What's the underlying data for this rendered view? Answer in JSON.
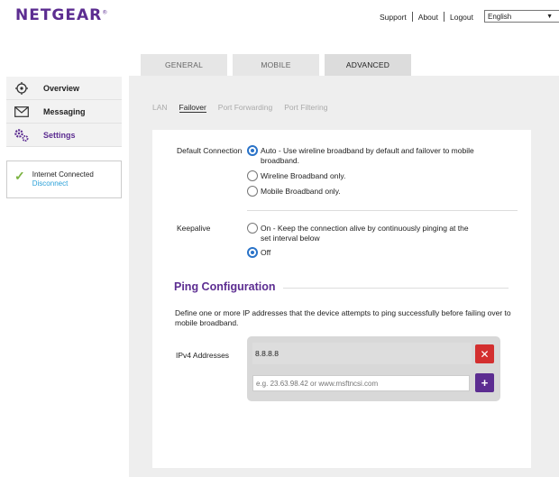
{
  "brand": {
    "name": "NETGEAR",
    "mark": "®"
  },
  "header": {
    "links": [
      "Support",
      "About",
      "Logout"
    ],
    "language": "English"
  },
  "tabs": [
    {
      "label": "GENERAL",
      "active": false
    },
    {
      "label": "MOBILE",
      "active": false
    },
    {
      "label": "ADVANCED",
      "active": true
    }
  ],
  "sidebar": {
    "items": [
      {
        "label": "Overview",
        "icon": "network-globe-icon",
        "active": false
      },
      {
        "label": "Messaging",
        "icon": "envelope-icon",
        "active": false
      },
      {
        "label": "Settings",
        "icon": "gears-icon",
        "active": true
      }
    ],
    "status": {
      "text": "Internet Connected",
      "link": "Disconnect",
      "icon": "checkmark-icon"
    }
  },
  "subtabs": [
    {
      "label": "LAN",
      "active": false
    },
    {
      "label": "Failover",
      "active": true
    },
    {
      "label": "Port Forwarding",
      "active": false
    },
    {
      "label": "Port Filtering",
      "active": false
    }
  ],
  "default_connection": {
    "label": "Default Connection",
    "options": [
      {
        "line1": "Auto - Use wireline broadband by default and failover to mobile",
        "line2": "broadband.",
        "selected": true
      },
      {
        "line1": "Wireline Broadband only.",
        "line2": "",
        "selected": false
      },
      {
        "line1": "Mobile Broadband only.",
        "line2": "",
        "selected": false
      }
    ]
  },
  "keepalive": {
    "label": "Keepalive",
    "options": [
      {
        "line1": "On - Keep the connection alive by continuously pinging at the",
        "line2": "set interval below",
        "selected": false
      },
      {
        "line1": "Off",
        "line2": "",
        "selected": true
      }
    ]
  },
  "ping": {
    "title": "Ping Configuration",
    "description": "Define one or more IP addresses that the device attempts to ping successfully before failing over to mobile broadband.",
    "ipv4_label": "IPv4 Addresses",
    "addresses": [
      "8.8.8.8"
    ],
    "placeholder": "e.g. 23.63.98.42 or www.msftncsi.com",
    "delete_symbol": "✕",
    "add_symbol": "+"
  },
  "colors": {
    "brand": "#5c2d91",
    "link": "#2aa0d8",
    "delete": "#d32f2f",
    "radio": "#2a73c8",
    "success": "#7cb342"
  }
}
